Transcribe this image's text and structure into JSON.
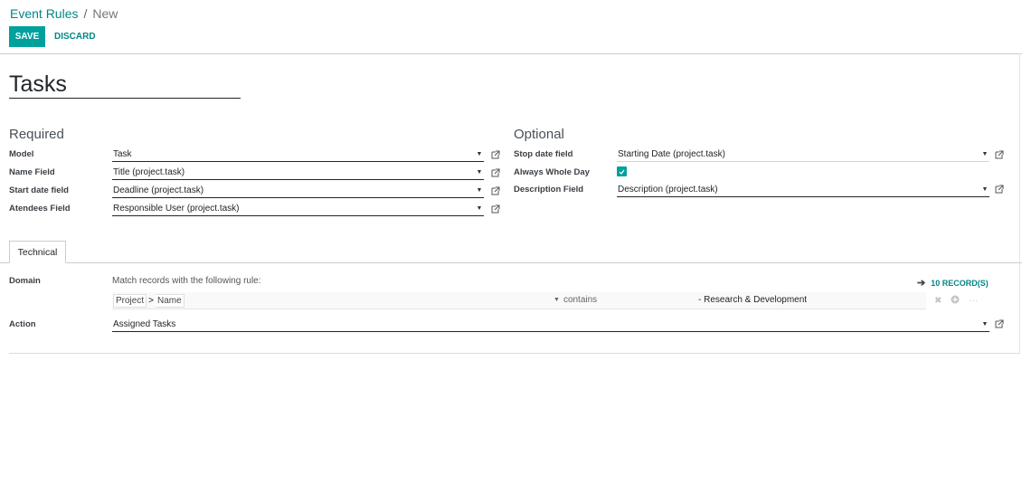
{
  "breadcrumb": {
    "parent": "Event Rules",
    "separator": "/",
    "current": "New"
  },
  "toolbar": {
    "save_label": "SAVE",
    "discard_label": "DISCARD"
  },
  "record": {
    "name": "Tasks"
  },
  "required": {
    "title": "Required",
    "fields": [
      {
        "label": "Model",
        "value": "Task"
      },
      {
        "label": "Name Field",
        "value": "Title (project.task)"
      },
      {
        "label": "Start date field",
        "value": "Deadline (project.task)"
      },
      {
        "label": "Atendees Field",
        "value": "Responsible User (project.task)"
      }
    ]
  },
  "optional": {
    "title": "Optional",
    "stop_date": {
      "label": "Stop date field",
      "value": "Starting Date (project.task)"
    },
    "whole_day": {
      "label": "Always Whole Day",
      "checked": true
    },
    "description": {
      "label": "Description Field",
      "value": "Description (project.task)"
    }
  },
  "tabs": [
    {
      "label": "Technical"
    }
  ],
  "technical": {
    "domain_label": "Domain",
    "match_text": "Match records with the following rule:",
    "records_link": "10 RECORD(S)",
    "rule": {
      "path": [
        "Project",
        "Name"
      ],
      "operator": "contains",
      "value": "- Research & Development"
    },
    "action_label": "Action",
    "action_value": "Assigned Tasks"
  },
  "colors": {
    "primary": "#00A09D",
    "link": "#008784"
  }
}
